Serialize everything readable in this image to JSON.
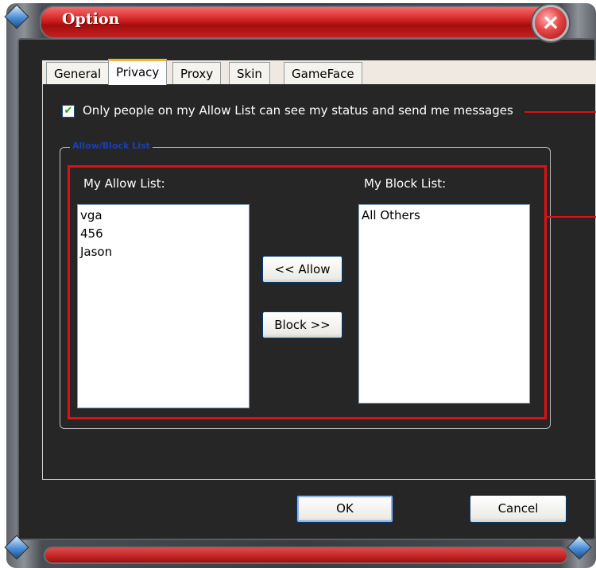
{
  "window": {
    "title": "Option"
  },
  "tabs": [
    {
      "label": "General"
    },
    {
      "label": "Privacy"
    },
    {
      "label": "Proxy"
    },
    {
      "label": "Skin"
    },
    {
      "label": "GameFace"
    }
  ],
  "privacy": {
    "allow_only_checked": true,
    "allow_only_label": "Only people on my Allow List can see my status and send me messages",
    "group_title": "Allow/Block List",
    "allow_list_label": "My Allow List:",
    "block_list_label": "My Block List:",
    "allow_list": [
      "vga",
      "456",
      "Jason"
    ],
    "block_list": [
      "All Others"
    ],
    "allow_button": "<< Allow",
    "block_button": "Block >>"
  },
  "footer": {
    "ok": "OK",
    "cancel": "Cancel"
  },
  "colors": {
    "accent_red": "#e01010",
    "title_red": "#d42727",
    "panel_bg": "#262626",
    "legend_blue": "#1a3fb8"
  },
  "icons": {
    "close": "close-icon",
    "check": "checkmark-icon"
  }
}
